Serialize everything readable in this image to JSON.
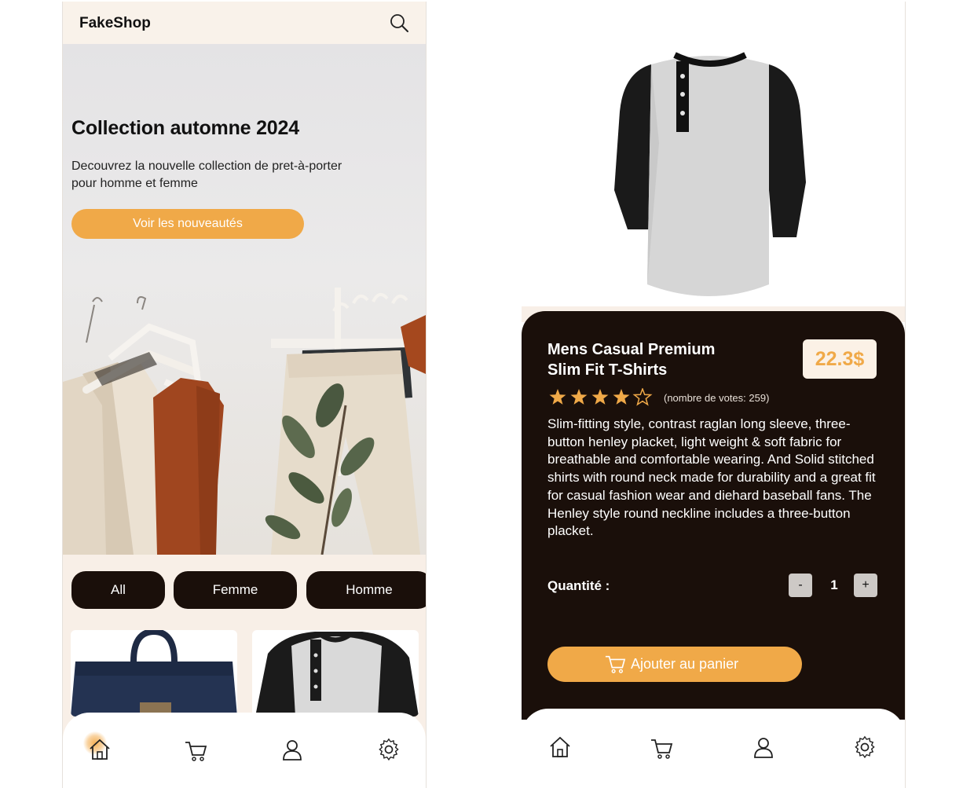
{
  "home": {
    "app_name": "FakeShop",
    "hero": {
      "title": "Collection automne 2024",
      "text": "Decouvrez la nouvelle collection de pret-à-porter pour homme et femme",
      "button": "Voir les nouveautés"
    },
    "filters": [
      "All",
      "Femme",
      "Homme"
    ],
    "nav": [
      "home-icon",
      "cart-icon",
      "user-icon",
      "settings-icon"
    ]
  },
  "product": {
    "title_line1": "Mens Casual Premium",
    "title_line2": "Slim Fit T-Shirts",
    "price": "22.3$",
    "rating": 4,
    "rating_max": 5,
    "votes": "(nombre de votes: 259)",
    "description": "Slim-fitting style, contrast raglan long sleeve, three-button henley placket, light weight & soft fabric for breathable and comfortable wearing. And Solid stitched shirts with round neck made for durability and a great fit for casual fashion wear and diehard baseball fans. The Henley style round neckline includes a three-button placket.",
    "quantity_label": "Quantité :",
    "minus": "-",
    "quantity": "1",
    "plus": "+",
    "add_to_cart": "Ajouter au panier"
  },
  "colors": {
    "accent": "#f0a948",
    "dark": "#1a0f0a",
    "cream": "#f8efe7"
  }
}
